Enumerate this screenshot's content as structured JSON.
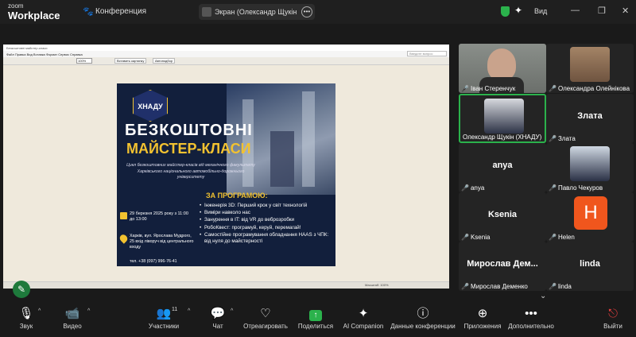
{
  "app": {
    "zoom_text": "zoom",
    "workplace_text": "Workplace"
  },
  "meeting": {
    "title": "Конференция"
  },
  "share_pill": {
    "label": "Экран (Олександр Щукін (ХНАД"
  },
  "view": {
    "label": "Вид"
  },
  "ppt": {
    "window_title": "Безкоштовні майстер-класи",
    "menu": "Файл   Правка   Вид   Вставка   Формат   Сервис   Справка",
    "zoom": "100%",
    "btn_insert": "Вставить картинку",
    "btn_auto": "Автоподбор",
    "search_placeholder": "Введите вопрос",
    "status": "Масштаб: 100%"
  },
  "poster": {
    "logo_text": "ХНАДУ",
    "headline1": "БЕЗКОШТОВНІ",
    "headline2": "МАЙСТЕР-КЛАСИ",
    "description": "Цикл безкоштовних майстер-класів від механічного факультету Харківського національного автомобільно-дорожнього університету",
    "program_title": "ЗА ПРОГРАМОЮ:",
    "program_items": [
      "Інженерія 3D: Перший крок у світ технологій",
      "Виміри навколо нас",
      "Занурення в IT: від VR до веброзробки",
      "РобоКвест: програмуй, керуй, перемагай!",
      "Самостійне програмування обладнання HAAS з ЧПК: від нуля до майстерності"
    ],
    "date_text": "29 березня 2025 року з 11:00 до 13:00",
    "address_text": "Харків, вул. Ярослава Мудрого, 25 вхід ліворуч від центрального входу",
    "phone_text": "тел. +38 (097) 996-76-41"
  },
  "participants": [
    {
      "name": "Іван Стеренчук",
      "type": "video",
      "muted": true
    },
    {
      "name": "Олександра Олейнікова",
      "type": "video",
      "muted": true
    },
    {
      "name": "Олександр Щукін (ХНАДУ)",
      "type": "video",
      "muted": false,
      "active": true
    },
    {
      "name": "Злата",
      "type": "name",
      "muted": true
    },
    {
      "name": "anya",
      "type": "name",
      "muted": true
    },
    {
      "name": "Павло Чекуров",
      "type": "video",
      "muted": true
    },
    {
      "name": "Ksenia",
      "type": "name",
      "muted": true
    },
    {
      "name": "Helen",
      "type": "initial",
      "initial": "H",
      "muted": true
    },
    {
      "name": "Мирослав Деменко",
      "big_label": "Мирослав Дем...",
      "type": "name",
      "muted": true
    },
    {
      "name": "linda",
      "type": "name",
      "muted": true
    }
  ],
  "toolbar": {
    "sound": "Звук",
    "video": "Видео",
    "participants": "Участники",
    "participants_count": "11",
    "chat": "Чат",
    "react": "Отреагировать",
    "share": "Поделиться",
    "companion": "AI Companion",
    "meeting_data": "Данные конференции",
    "apps": "Приложения",
    "more": "Дополнительно",
    "leave": "Выйти"
  },
  "colors": {
    "accent_green": "#2bb24c",
    "mute_red": "#e03c3c",
    "poster_bg": "#121f3c",
    "poster_gold": "#f2c230",
    "helen_orange": "#f0561d"
  }
}
